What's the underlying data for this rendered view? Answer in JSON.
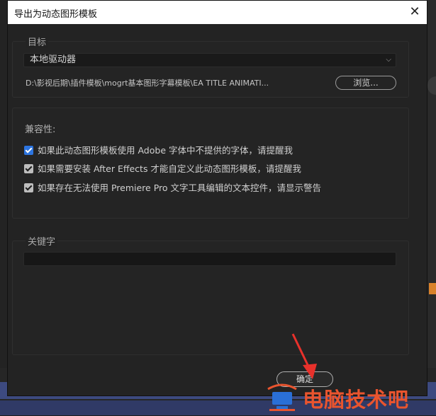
{
  "dialog": {
    "title": "导出为动态图形模板",
    "close_glyph": "✕"
  },
  "target": {
    "legend": "目标",
    "destination_value": "本地驱动器",
    "path": "D:\\影视后期\\插件模板\\mogrt基本图形字幕模板\\EA TITLE ANIMATI...",
    "browse_label": "浏览..."
  },
  "compatibility": {
    "title": "兼容性:",
    "options": [
      {
        "label": "如果此动态图形模板使用 Adobe 字体中不提供的字体，请提醒我",
        "checked": true,
        "style": "blue"
      },
      {
        "label": "如果需要安装 After Effects 才能自定义此动态图形模板，请提醒我",
        "checked": true,
        "style": "gray"
      },
      {
        "label": "如果存在无法使用 Premiere Pro 文字工具编辑的文本控件，请显示警告",
        "checked": true,
        "style": "gray"
      }
    ]
  },
  "keywords": {
    "legend": "关键字",
    "value": ""
  },
  "footer": {
    "ok_label": "确定"
  },
  "watermark": {
    "text": "电脑技术吧"
  },
  "colors": {
    "accent_blue": "#2d75e0",
    "arrow_red": "#e8312b",
    "watermark_orange": "#e9542e"
  }
}
